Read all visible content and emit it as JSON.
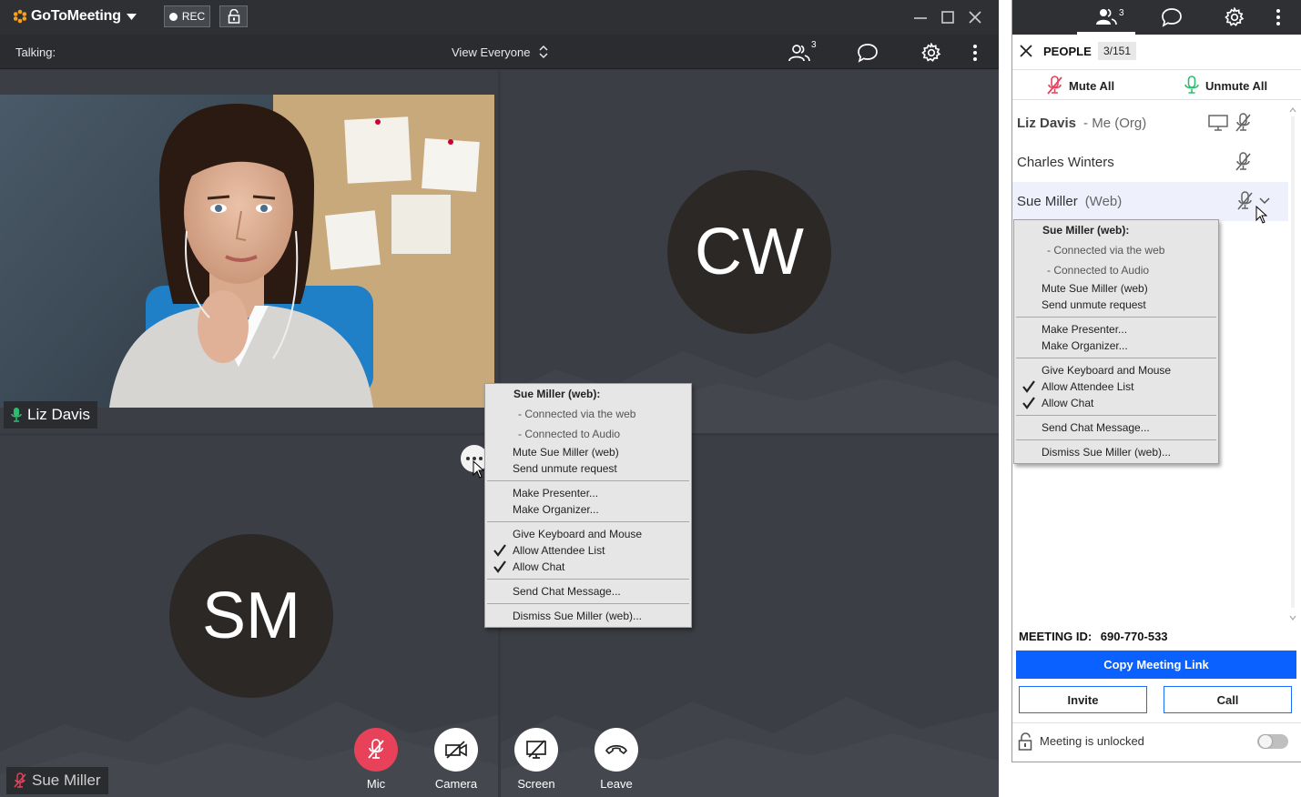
{
  "app": {
    "brand": "GoToMeeting",
    "rec_label": "REC"
  },
  "topbar": {
    "talking_label": "Talking:",
    "view_label": "View Everyone",
    "people_count": "3"
  },
  "tiles": {
    "liz": {
      "name": "Liz  Davis"
    },
    "cw": {
      "initials": "CW"
    },
    "sm": {
      "initials": "SM",
      "name": "Sue Miller"
    }
  },
  "controls": [
    {
      "label": "Mic"
    },
    {
      "label": "Camera"
    },
    {
      "label": "Screen"
    },
    {
      "label": "Leave"
    }
  ],
  "context_menu": {
    "header": "Sue Miller (web):",
    "info": [
      "- Connected via the web",
      "- Connected to Audio"
    ],
    "items": {
      "mute": "Mute Sue Miller (web)",
      "unmute_request": "Send unmute request",
      "make_presenter": "Make Presenter...",
      "make_organizer": "Make Organizer...",
      "give_keyboard": "Give Keyboard and Mouse",
      "allow_attendee_list": "Allow Attendee List",
      "allow_chat": "Allow Chat",
      "send_chat": "Send Chat Message...",
      "dismiss": "Dismiss Sue Miller (web)..."
    }
  },
  "panel": {
    "tab_people_count": "3",
    "title": "PEOPLE",
    "count": "3/151",
    "mute_all": "Mute All",
    "unmute_all": "Unmute All",
    "participants": [
      {
        "name": "Liz Davis",
        "type": "- Me (Org)"
      },
      {
        "name": "Charles Winters",
        "type": ""
      },
      {
        "name": "Sue Miller",
        "type": "(Web)"
      }
    ],
    "meeting_id_label": "MEETING ID:",
    "meeting_id": "690-770-533",
    "copy_link": "Copy Meeting Link",
    "invite": "Invite",
    "call": "Call",
    "lock_status": "Meeting is unlocked"
  },
  "colors": {
    "accent": "#0a61ff",
    "mic_muted": "#e8425a",
    "mic_active": "#2dbd6e",
    "logo": "#f7a11a"
  }
}
